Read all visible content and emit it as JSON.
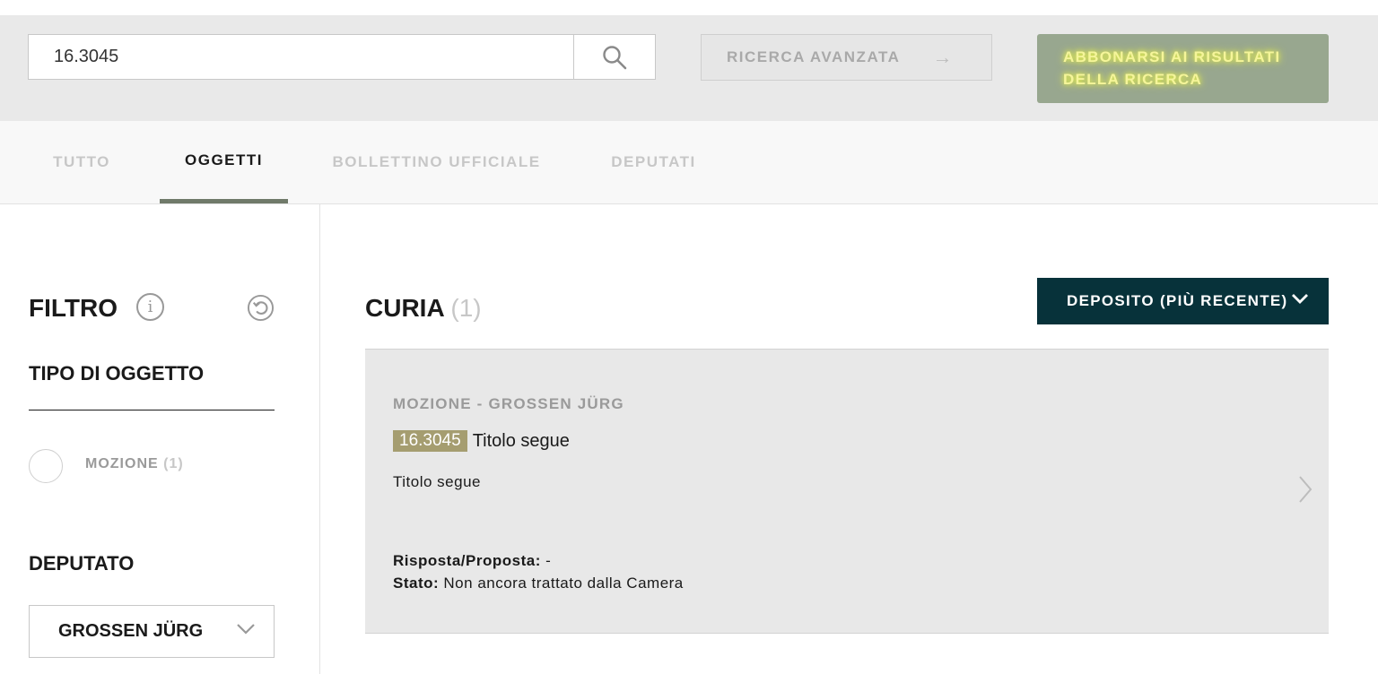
{
  "search": {
    "value": "16.3045",
    "advanced_label": "RICERCA AVANZATA",
    "subscribe_label_line1": "ABBONARSI AI RISULTATI",
    "subscribe_label_line2": "DELLA RICERCA"
  },
  "tabs": [
    {
      "label": "TUTTO",
      "active": false
    },
    {
      "label": "OGGETTI",
      "active": true
    },
    {
      "label": "BOLLETTINO UFFICIALE",
      "active": false
    },
    {
      "label": "DEPUTATI",
      "active": false
    }
  ],
  "sidebar": {
    "title": "FILTRO",
    "object_type_title": "TIPO DI OGGETTO",
    "object_types": [
      {
        "label": "MOZIONE",
        "count": "(1)"
      }
    ],
    "deputy_title": "DEPUTATO",
    "deputy_selected": "GROSSEN JÜRG"
  },
  "main": {
    "title": "CURIA",
    "count": "(1)",
    "sort_label": "DEPOSITO (PIÙ RECENTE)",
    "results": [
      {
        "type": "MOZIONE - GROSSEN JÜRG",
        "id": "16.3045",
        "title": "Titolo segue",
        "subtitle": "Titolo segue",
        "answer_label": "Risposta/Proposta:",
        "answer_value": "-",
        "status_label": "Stato:",
        "status_value": "Non ancora trattato dalla Camera"
      }
    ]
  },
  "colors": {
    "accent_dark": "#07323a",
    "subscribe_bg": "#98a78f",
    "highlight": "#a59d70",
    "tab_indicator": "#707a6a"
  }
}
